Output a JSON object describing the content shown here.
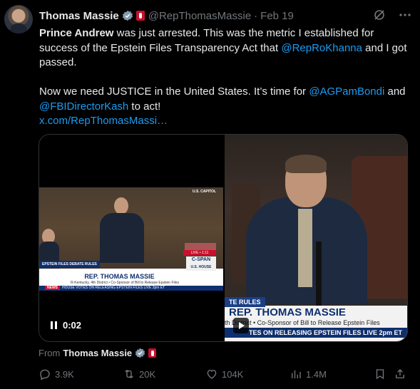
{
  "tweet": {
    "author_name": "Thomas Massie",
    "handle": "@RepThomasMassie",
    "separator": "·",
    "date": "Feb 19",
    "body": {
      "p1_bold": "Prince Andrew",
      "p1_a": " was just arrested. This was the metric I established for success of the Epstein Files Transparency Act that ",
      "p1_mention": "@RepRoKhanna",
      "p1_b": " and I got passed.",
      "p2_a": "Now we need JUSTICE in the United States. It’s time for ",
      "p2_mention1": "@AGPamBondi",
      "p2_b": " and ",
      "p2_mention2": "@FBIDirectorKash",
      "p2_c": " to act!",
      "link": "x.com/RepThomasMassi…"
    },
    "media": {
      "left_video": {
        "time": "0:02",
        "tag": "EPSTEIN FILES DEBATE RULES",
        "banner_name": "REP. THOMAS MASSIE",
        "banner_sub": "R-Kentucky, 4th District  •  Co-Sponsor of Bill to Release Epstein Files",
        "news_label": "NEWS",
        "strip": "HOUSE VOTES ON RELEASING EPSTEIN FILES  LIVE 2pm ET",
        "live": "LIVE • 1:11",
        "network": "C-SPAN",
        "network_sub": "U.S. HOUSE",
        "capitol": "U.S. CAPITOL"
      },
      "right_image": {
        "tag": "TE RULES",
        "name": "REP. THOMAS MASSIE",
        "sub": "th District  •  Co-Sponsor of Bill to Release Epstein Files",
        "strip": "TES ON RELEASING EPSTEIN FILES  LIVE 2pm ET"
      }
    },
    "from": {
      "label": "From",
      "name": "Thomas Massie"
    },
    "actions": {
      "replies": "3.9K",
      "reposts": "20K",
      "likes": "104K",
      "views": "1.4M"
    },
    "icons": [
      "verified-icon",
      "government-badge-icon",
      "grok-icon",
      "more-icon",
      "reply-icon",
      "repost-icon",
      "like-icon",
      "views-icon",
      "bookmark-icon",
      "share-icon",
      "pause-icon",
      "play-icon"
    ],
    "colors": {
      "background": "#000000",
      "text": "#e7e9ea",
      "muted": "#71767b",
      "accent": "#1d9bf0",
      "gov_red": "#c8102e"
    }
  }
}
